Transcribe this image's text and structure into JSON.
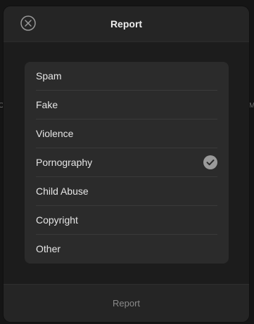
{
  "background": {
    "left_edge_text": "O",
    "right_edge_text": "M"
  },
  "modal": {
    "title": "Report",
    "close_icon": "close-circle-icon",
    "reasons": [
      {
        "label": "Spam",
        "selected": false
      },
      {
        "label": "Fake",
        "selected": false
      },
      {
        "label": "Violence",
        "selected": false
      },
      {
        "label": "Pornography",
        "selected": true
      },
      {
        "label": "Child Abuse",
        "selected": false
      },
      {
        "label": "Copyright",
        "selected": false
      },
      {
        "label": "Other",
        "selected": false
      }
    ],
    "footer_button_label": "Report",
    "footer_button_enabled": false
  },
  "colors": {
    "modal_bg": "#1c1c1c",
    "header_bg": "#252525",
    "list_bg": "#2b2b2b",
    "check_bg": "#9a9a9a",
    "disabled_text": "#8a8a8a"
  }
}
